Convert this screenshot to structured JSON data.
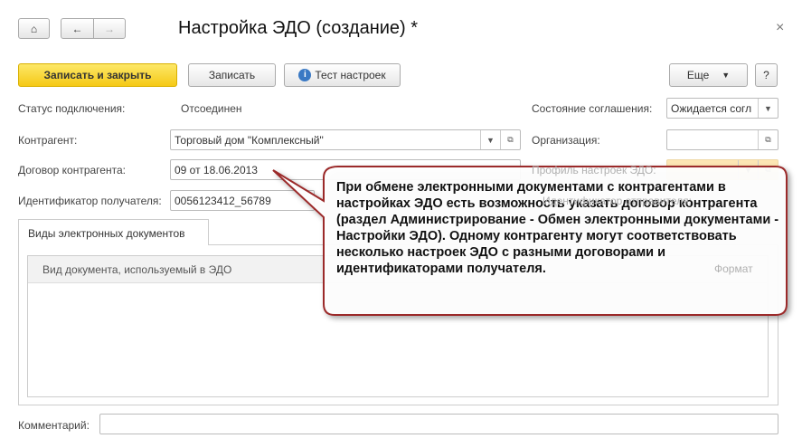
{
  "window": {
    "title": "Настройка ЭДО (создание) *",
    "close": "×"
  },
  "toolbar": {
    "save_close": "Записать и закрыть",
    "save": "Записать",
    "test": "Тест настроек",
    "more": "Еще",
    "help": "?"
  },
  "form": {
    "status_label": "Статус подключения:",
    "status_value": "Отсоединен",
    "agreement_label": "Состояние соглашения:",
    "agreement_value": "Ожидается согл",
    "counterparty_label": "Контрагент:",
    "counterparty_value": "Торговый дом \"Комплексный\"",
    "org_label": "Организация:",
    "org_value": "",
    "contract_label": "Договор контрагента:",
    "contract_value": "09 от 18.06.2013",
    "profile_label": "Профиль настроек ЭДО:",
    "recipient_label": "Идентификатор получателя:",
    "recipient_value": "0056123412_56789",
    "sender_label": "Идентификатор отправителя:",
    "comment_label": "Комментарий:",
    "comment_value": ""
  },
  "tabs": [
    {
      "label": "Виды электронных документов"
    }
  ],
  "table": {
    "columns": [
      "Вид документа, используемый в ЭДО",
      "Формат"
    ]
  },
  "callout": {
    "text": "При обмене электронными документами с контрагентами в настройках ЭДО есть возможность указать договор контрагента (раздел Администрирование - Обмен электронными документами - Настройки ЭДО). Одному контрагенту могут соответствовать несколько настроек ЭДО с разными договорами и идентификаторами получателя.",
    "border_color": "#9b2a2a"
  }
}
